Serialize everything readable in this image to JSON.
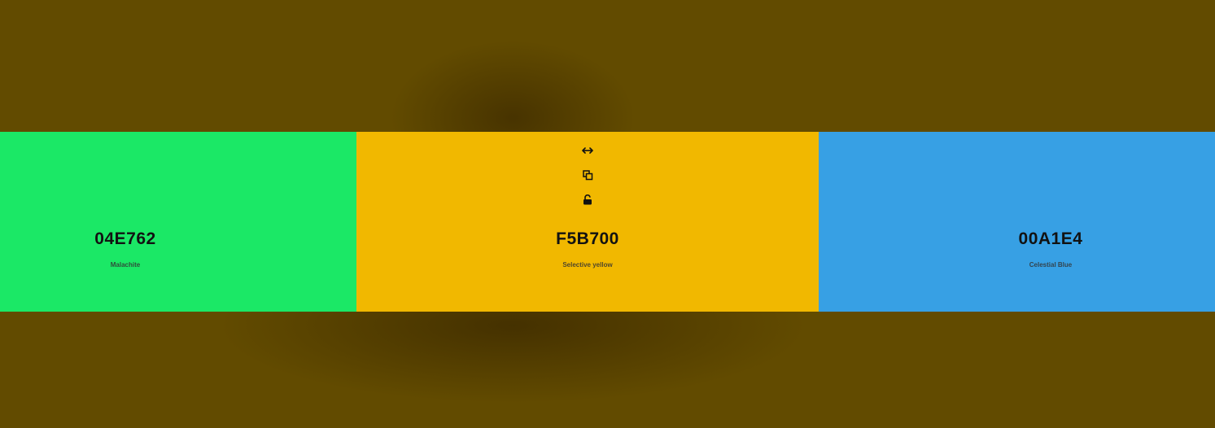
{
  "colors": {
    "background": "#624b00",
    "swatch_green": "#1be866",
    "swatch_yellow": "#f1b800",
    "swatch_blue": "#37a0e4"
  },
  "swatches": [
    {
      "hex": "04E762",
      "name": "Malachite"
    },
    {
      "hex": "F5B700",
      "name": "Selective yellow"
    },
    {
      "hex": "00A1E4",
      "name": "Celestial Blue"
    }
  ],
  "tools": {
    "icons": [
      "drag-horizontal-icon",
      "copy-icon",
      "unlock-icon"
    ]
  }
}
